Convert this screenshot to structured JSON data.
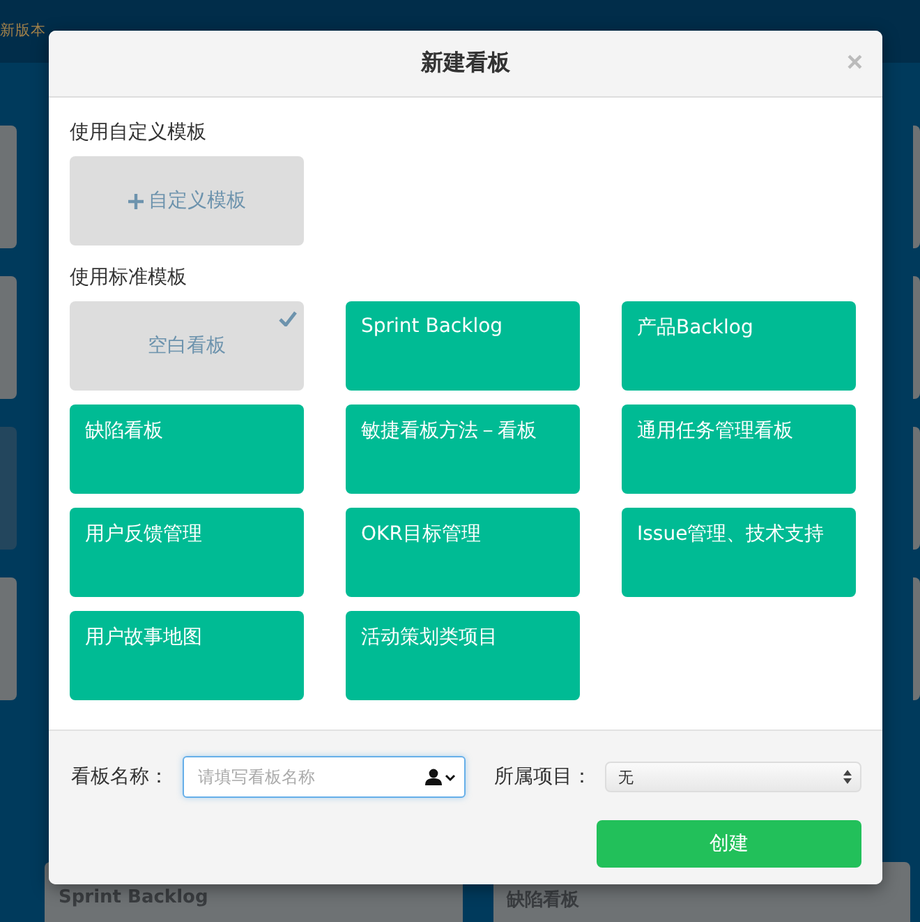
{
  "background": {
    "banner": "新版本",
    "cards": [
      {
        "title": "Sprint Backlog"
      },
      {
        "title": "缺陷看板"
      }
    ]
  },
  "dialog": {
    "title": "新建看板",
    "close": "×",
    "custom": {
      "label": "使用自定义模板",
      "button": "自定义模板"
    },
    "standard": {
      "label": "使用标准模板",
      "templates": [
        {
          "name": "空白看板",
          "selected": true
        },
        {
          "name": "Sprint Backlog",
          "selected": false
        },
        {
          "name": "产品Backlog",
          "selected": false
        },
        {
          "name": "缺陷看板",
          "selected": false
        },
        {
          "name": "敏捷看板方法－看板",
          "selected": false
        },
        {
          "name": "通用任务管理看板",
          "selected": false
        },
        {
          "name": "用户反馈管理",
          "selected": false
        },
        {
          "name": "OKR目标管理",
          "selected": false
        },
        {
          "name": "Issue管理、技术支持",
          "selected": false
        },
        {
          "name": "用户故事地图",
          "selected": false
        },
        {
          "name": "活动策划类项目",
          "selected": false
        }
      ]
    },
    "name_field": {
      "label": "看板名称：",
      "placeholder": "请填写看板名称"
    },
    "project_field": {
      "label": "所属项目：",
      "value": "无"
    },
    "submit": "创建"
  }
}
